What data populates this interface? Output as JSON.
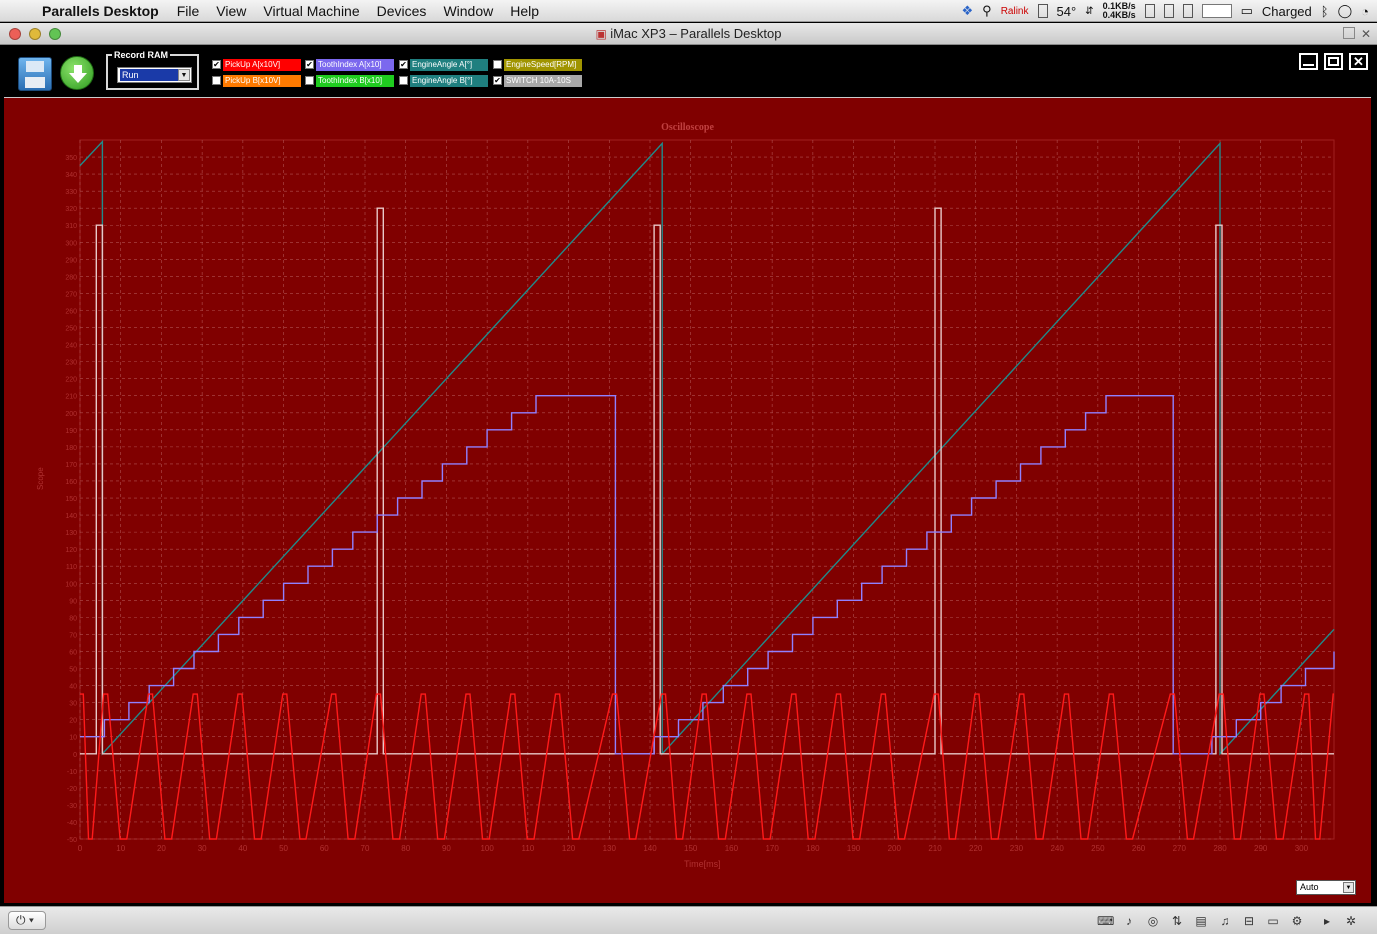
{
  "menubar": {
    "app_name": "Parallels Desktop",
    "menus": [
      "File",
      "View",
      "Virtual Machine",
      "Devices",
      "Window",
      "Help"
    ],
    "status": {
      "temp": "54°",
      "net_up": "0.1KB/s",
      "net_down": "0.4KB/s",
      "wifi_name": "Ralink",
      "battery": "Charged"
    }
  },
  "window": {
    "title": "iMac XP3 – Parallels Desktop"
  },
  "toolbar": {
    "record_ram_label": "Record RAM",
    "record_ram_value": "Run",
    "channels": [
      {
        "label": "PickUp A[x10V]",
        "checked": true,
        "color": "#ff0000"
      },
      {
        "label": "ToothIndex A[x10]",
        "checked": true,
        "color": "#7b68ee"
      },
      {
        "label": "EngineAngle A[°]",
        "checked": true,
        "color": "#1f8b8b"
      },
      {
        "label": "EngineSpeed[RPM]",
        "checked": false,
        "color": "#b5a800"
      },
      {
        "label": "PickUp B[x10V]",
        "checked": false,
        "color": "#ff7a00"
      },
      {
        "label": "ToothIndex B[x10]",
        "checked": false,
        "color": "#1fdc1f"
      },
      {
        "label": "EngineAngle B[°]",
        "checked": false,
        "color": "#1f8b8b"
      },
      {
        "label": "SWITCH 10A-10S",
        "checked": true,
        "color": "#c0c0c0"
      }
    ]
  },
  "scope": {
    "auto_label": "Auto"
  },
  "chart_data": {
    "type": "line",
    "title": "Oscilloscope",
    "xlabel": "Time[ms]",
    "ylabel": "Scope",
    "xlim": [
      0,
      308
    ],
    "ylim": [
      -50,
      360
    ],
    "xticks": [
      0,
      10,
      20,
      30,
      40,
      50,
      60,
      70,
      80,
      90,
      100,
      110,
      120,
      130,
      140,
      150,
      160,
      170,
      180,
      190,
      200,
      210,
      220,
      230,
      240,
      250,
      260,
      270,
      280,
      290,
      300
    ],
    "yticks": [
      -50,
      -40,
      -30,
      -20,
      -10,
      0,
      10,
      20,
      30,
      40,
      50,
      60,
      70,
      80,
      90,
      100,
      110,
      120,
      130,
      140,
      150,
      160,
      170,
      180,
      190,
      200,
      210,
      220,
      230,
      240,
      250,
      260,
      270,
      280,
      290,
      300,
      310,
      320,
      330,
      340,
      350
    ],
    "grid": true,
    "series": [
      {
        "name": "EngineAngle A[°]",
        "color": "#1f8b8b",
        "x": [
          0,
          5.5,
          5.5,
          143,
          143,
          280,
          280,
          308
        ],
        "y": [
          345,
          359,
          0,
          358,
          0,
          358,
          0,
          73
        ]
      },
      {
        "name": "SWITCH 10A-10S",
        "color": "#e8c8c8",
        "x": [
          0,
          4,
          4,
          5.5,
          5.5,
          73,
          73,
          74.5,
          74.5,
          141,
          141,
          142.5,
          142.5,
          210,
          210,
          211.5,
          211.5,
          279,
          279,
          280.5,
          280.5,
          308
        ],
        "y": [
          0,
          0,
          310,
          310,
          0,
          0,
          320,
          320,
          0,
          0,
          310,
          310,
          0,
          0,
          320,
          320,
          0,
          0,
          310,
          310,
          0,
          0
        ]
      },
      {
        "name": "ToothIndex A[x10]",
        "color": "#9080ff",
        "x": [
          0,
          4,
          6,
          12,
          17,
          23,
          28,
          34,
          39,
          45,
          50,
          56,
          62,
          67,
          73,
          78,
          84,
          89,
          95,
          100,
          106,
          112,
          117,
          123,
          131.5,
          141,
          147,
          153,
          158,
          164,
          169,
          175,
          180,
          186,
          192,
          197,
          203,
          208,
          214,
          219,
          225,
          231,
          236,
          242,
          247,
          252,
          261,
          268.5,
          278,
          284,
          290,
          295,
          301,
          308
        ],
        "y": [
          10,
          10,
          20,
          30,
          40,
          50,
          60,
          70,
          80,
          90,
          100,
          110,
          120,
          130,
          140,
          150,
          160,
          170,
          180,
          190,
          200,
          210,
          210,
          210,
          0,
          10,
          20,
          30,
          40,
          50,
          60,
          70,
          80,
          90,
          100,
          110,
          120,
          130,
          140,
          150,
          160,
          170,
          180,
          190,
          200,
          210,
          210,
          0,
          10,
          20,
          30,
          40,
          50,
          60
        ]
      },
      {
        "name": "PickUp A[x10V]",
        "color": "#ff1a1a",
        "teeth_x": [
          0,
          6,
          17,
          28,
          39,
          50,
          62,
          73,
          84,
          95,
          106,
          117,
          131,
          143,
          153,
          164,
          175,
          186,
          197,
          210,
          220,
          231,
          242,
          253,
          268,
          280,
          290,
          301
        ],
        "high": 35,
        "low": -50
      }
    ]
  },
  "statusbar": {
    "power_label": "⏻ ▾"
  }
}
